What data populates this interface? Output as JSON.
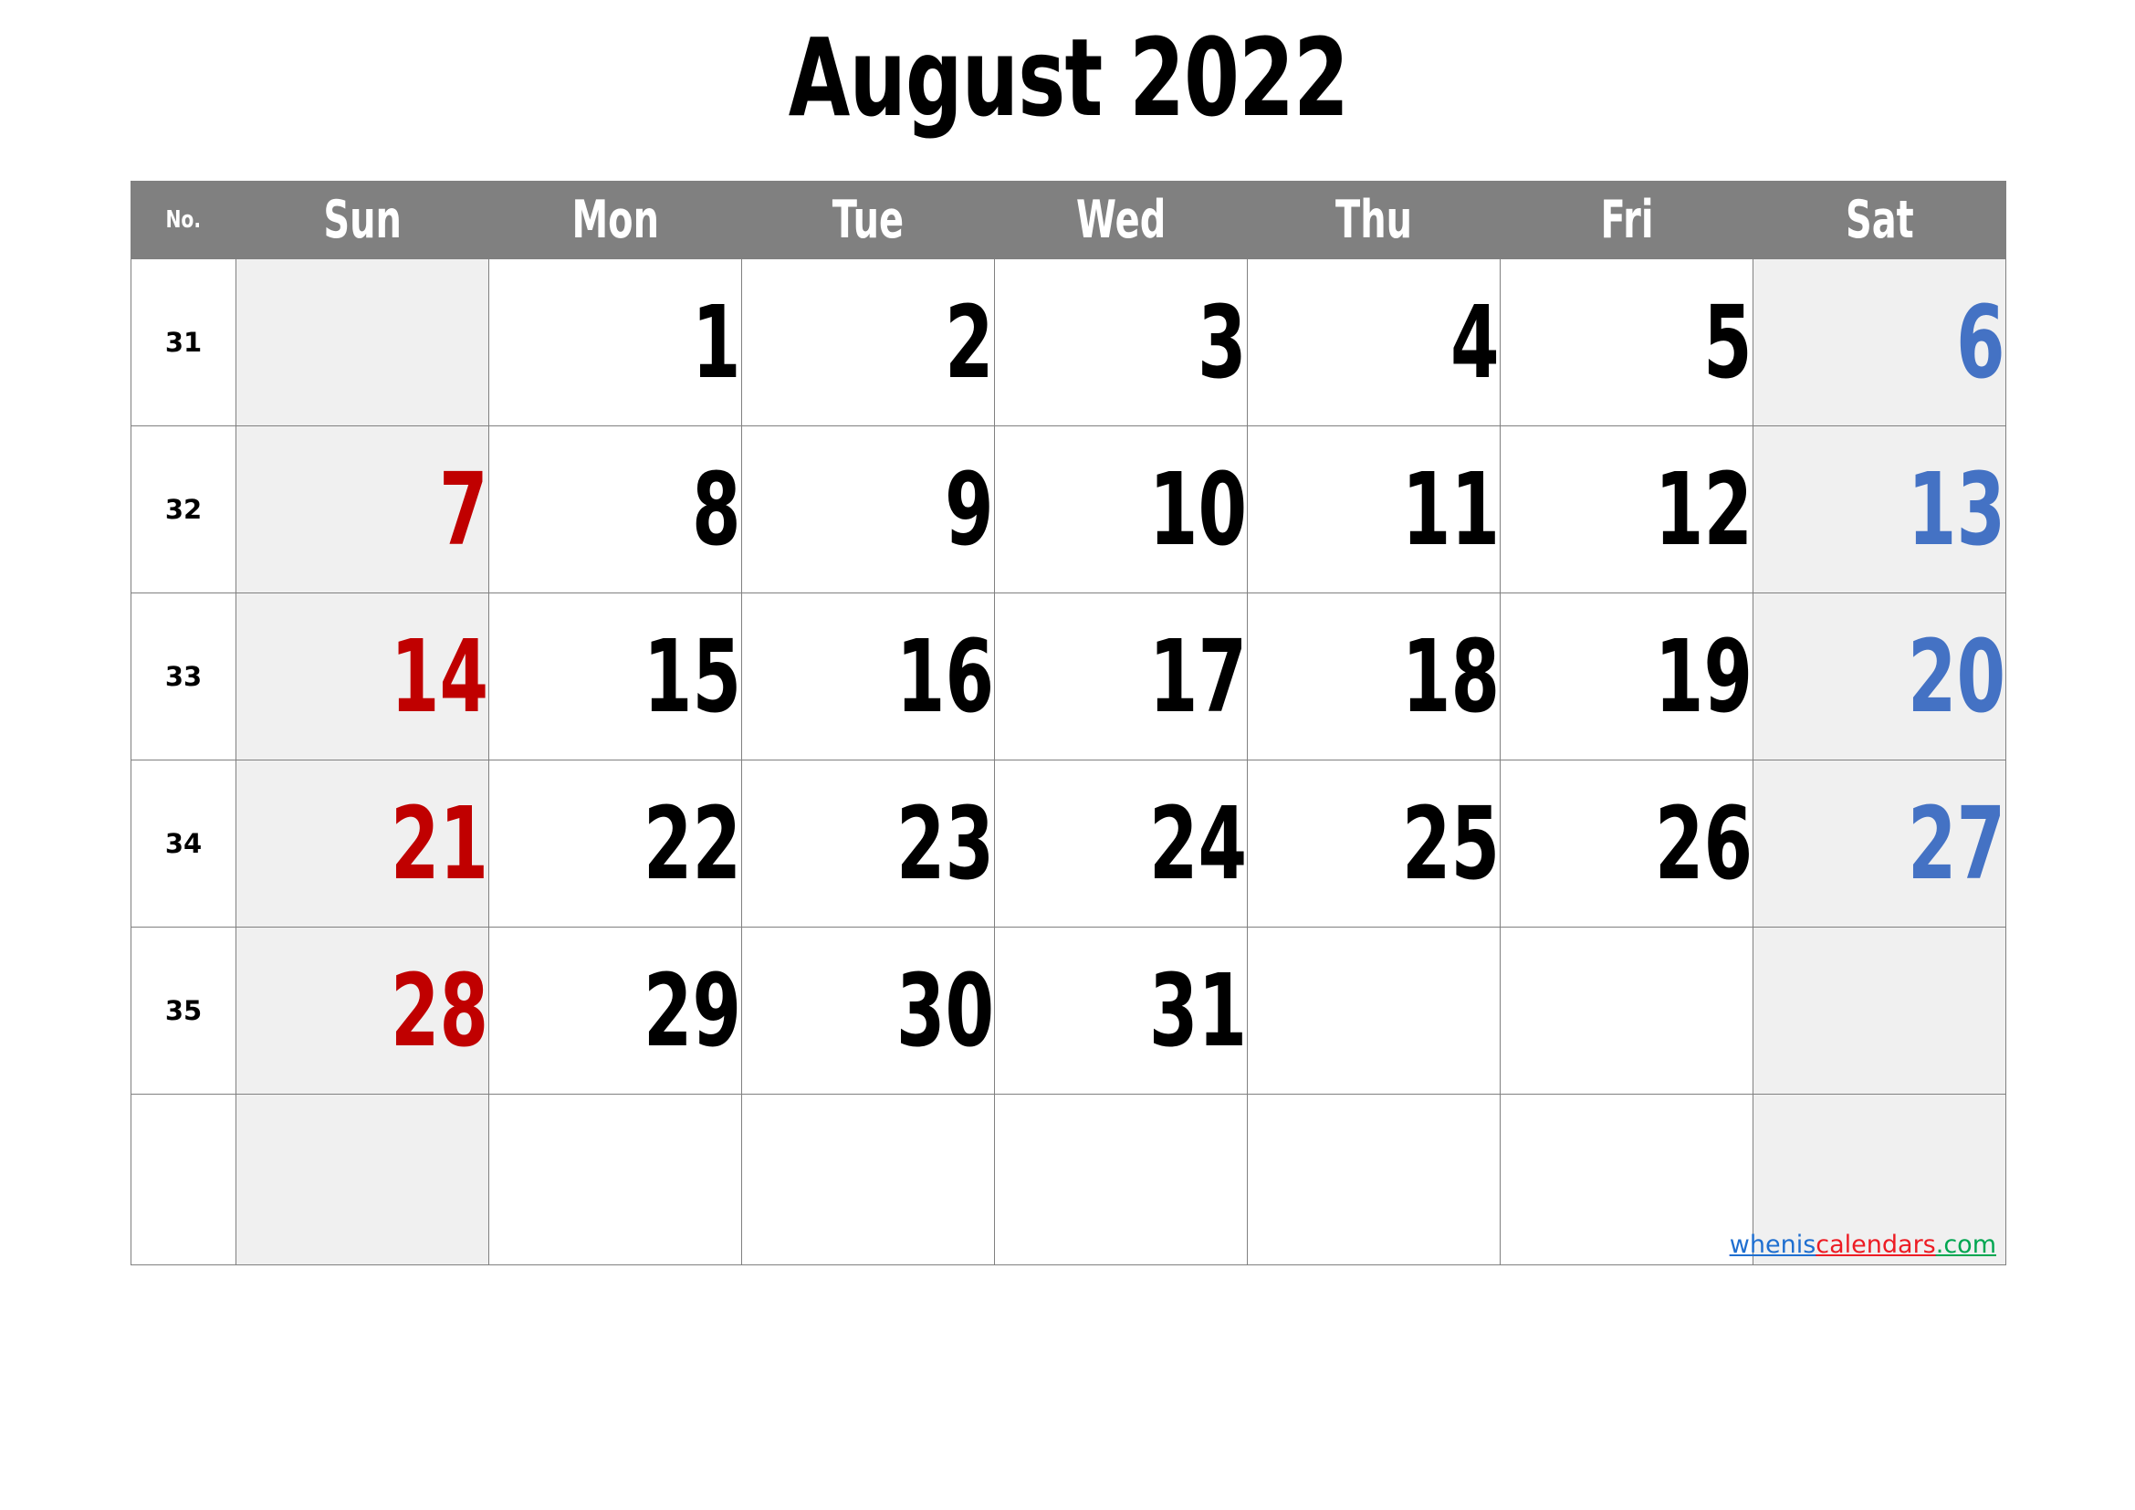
{
  "title": "August 2022",
  "header": {
    "week_number_label": "No.",
    "days": [
      "Sun",
      "Mon",
      "Tue",
      "Wed",
      "Thu",
      "Fri",
      "Sat"
    ]
  },
  "colors": {
    "header_background": "#808080",
    "header_text": "#ffffff",
    "weekend_cell_background": "#F0F0F0",
    "sunday_text": "#C00000",
    "saturday_text": "#4472C4",
    "weekday_text": "#000000",
    "grid_border": "#808080"
  },
  "weeks": [
    {
      "no": "31",
      "days": [
        "",
        "1",
        "2",
        "3",
        "4",
        "5",
        "6"
      ]
    },
    {
      "no": "32",
      "days": [
        "7",
        "8",
        "9",
        "10",
        "11",
        "12",
        "13"
      ]
    },
    {
      "no": "33",
      "days": [
        "14",
        "15",
        "16",
        "17",
        "18",
        "19",
        "20"
      ]
    },
    {
      "no": "34",
      "days": [
        "21",
        "22",
        "23",
        "24",
        "25",
        "26",
        "27"
      ]
    },
    {
      "no": "35",
      "days": [
        "28",
        "29",
        "30",
        "31",
        "",
        "",
        ""
      ]
    },
    {
      "no": "",
      "days": [
        "",
        "",
        "",
        "",
        "",
        "",
        ""
      ]
    }
  ],
  "watermark": {
    "part1": "whenis",
    "part2": "calendars",
    "part3": ".com"
  }
}
